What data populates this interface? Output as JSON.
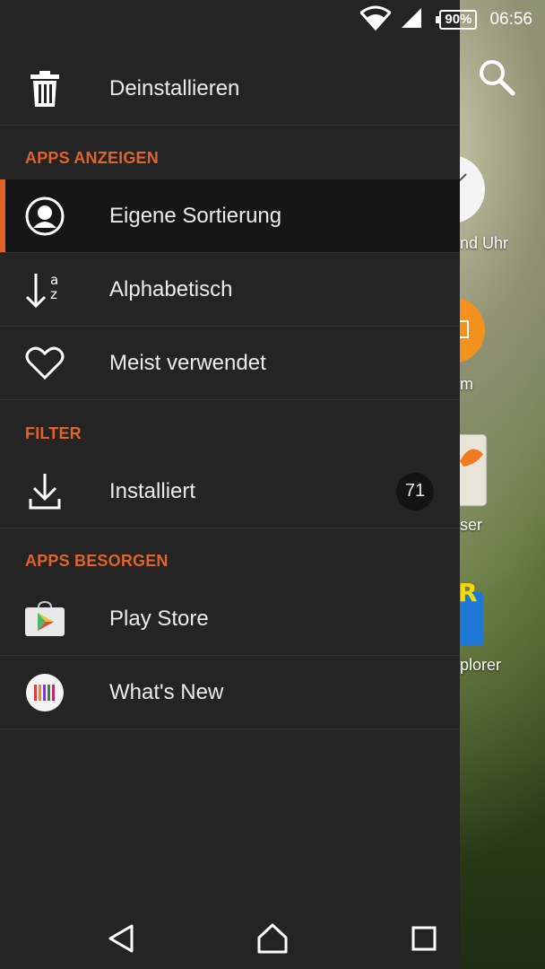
{
  "status_bar": {
    "battery": "90%",
    "time": "06:56",
    "icons": [
      "wifi-icon",
      "signal-icon",
      "battery-icon"
    ]
  },
  "background_apps": [
    {
      "label": "nd Uhr",
      "icon": "clock-icon"
    },
    {
      "label": "m",
      "icon": "orange-app-icon"
    },
    {
      "label": "ser",
      "icon": "browser-app-icon"
    },
    {
      "label": "plorer",
      "icon": "es-explorer-icon"
    }
  ],
  "drawer": {
    "top_item": {
      "label": "Deinstallieren",
      "icon": "trash-icon"
    },
    "sections": [
      {
        "title": "APPS ANZEIGEN",
        "items": [
          {
            "label": "Eigene Sortierung",
            "icon": "person-circle-icon",
            "selected": true
          },
          {
            "label": "Alphabetisch",
            "icon": "sort-az-icon"
          },
          {
            "label": "Meist verwendet",
            "icon": "heart-icon"
          }
        ]
      },
      {
        "title": "FILTER",
        "items": [
          {
            "label": "Installiert",
            "icon": "download-icon",
            "badge": "71"
          }
        ]
      },
      {
        "title": "APPS BESORGEN",
        "items": [
          {
            "label": "Play Store",
            "icon": "play-store-icon"
          },
          {
            "label": "What's New",
            "icon": "whats-new-icon"
          }
        ]
      }
    ]
  },
  "nav_bar": {
    "buttons": [
      "back-icon",
      "home-icon",
      "recents-icon"
    ]
  },
  "colors": {
    "accent": "#e0642a",
    "drawer_bg": "#242424",
    "selected_bg": "#161616"
  }
}
